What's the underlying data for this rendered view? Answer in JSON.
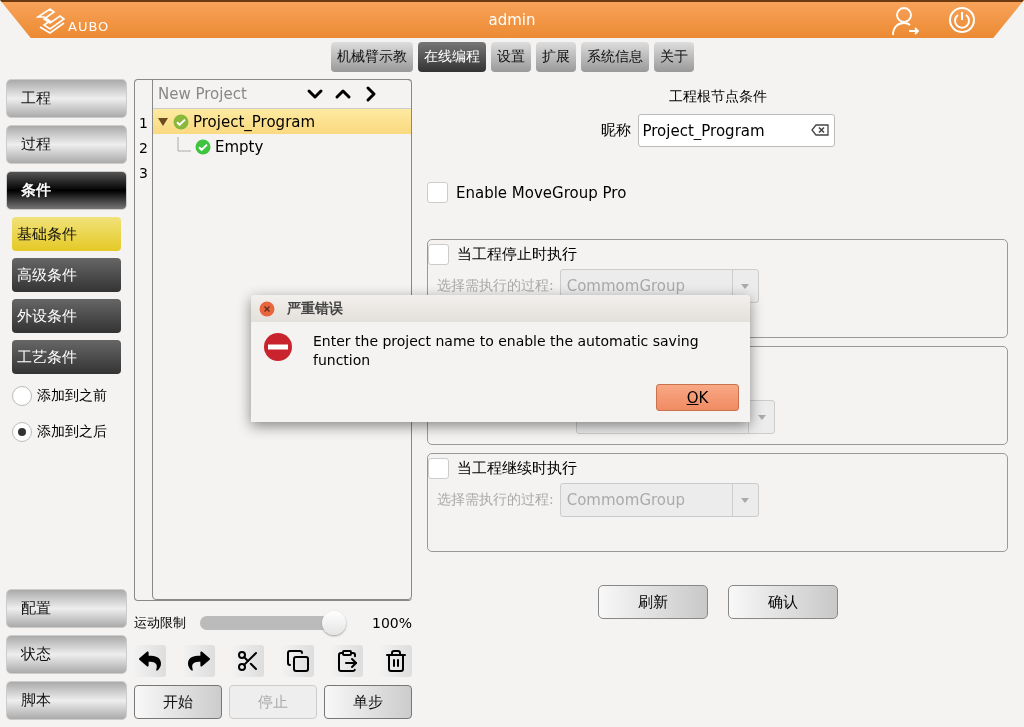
{
  "header": {
    "logo_text": "AUBO",
    "title": "admin"
  },
  "tabs": [
    {
      "label": "机械臂示教",
      "selected": false
    },
    {
      "label": "在线编程",
      "selected": true
    },
    {
      "label": "设置",
      "selected": false
    },
    {
      "label": "扩展",
      "selected": false
    },
    {
      "label": "系统信息",
      "selected": false
    },
    {
      "label": "关于",
      "selected": false
    }
  ],
  "sidebar": {
    "items": [
      {
        "label": "工程",
        "selected": false
      },
      {
        "label": "过程",
        "selected": false
      },
      {
        "label": "条件",
        "selected": true
      }
    ],
    "sub_items": [
      {
        "label": "基础条件",
        "selected": true
      },
      {
        "label": "高级条件",
        "selected": false
      },
      {
        "label": "外设条件",
        "selected": false
      },
      {
        "label": "工艺条件",
        "selected": false
      }
    ],
    "insert_options": [
      {
        "label": "添加到之前",
        "selected": false
      },
      {
        "label": "添加到之后",
        "selected": true
      }
    ],
    "bottom_items": [
      {
        "label": "配置"
      },
      {
        "label": "状态"
      },
      {
        "label": "脚本"
      }
    ]
  },
  "tree": {
    "title": "New Project",
    "line_numbers": [
      "1",
      "2",
      "3"
    ],
    "nodes": [
      {
        "label": "Project_Program",
        "selected": true,
        "expanded": true,
        "children": [
          {
            "label": "Empty",
            "selected": false
          }
        ]
      }
    ]
  },
  "speed_limit": {
    "label": "运动限制",
    "level": 1,
    "reading": "100%"
  },
  "run_buttons": [
    {
      "label": "开始",
      "disabled": false
    },
    {
      "label": "停止",
      "disabled": true
    },
    {
      "label": "单步",
      "disabled": false
    }
  ],
  "panel": {
    "title": "工程根节点条件",
    "nickname": {
      "label": "昵称",
      "value": "Project_Program"
    },
    "movegroup": {
      "label": "Enable MoveGroup Pro",
      "checked": false
    },
    "groups": [
      {
        "kind": "full",
        "title": "当工程停止时执行",
        "checked": false,
        "process_label": "选择需执行的过程:",
        "process_value": "CommomGroup"
      },
      {
        "kind": "covered"
      },
      {
        "kind": "full",
        "title": "当工程继续时执行",
        "checked": false,
        "process_label": "选择需执行的过程:",
        "process_value": "CommomGroup"
      }
    ],
    "buttons": [
      {
        "label": "刷新"
      },
      {
        "label": "确认"
      }
    ]
  },
  "dialog": {
    "title": "严重错误",
    "message": "Enter the project name to enable the automatic saving function",
    "ok_label": "OK"
  }
}
